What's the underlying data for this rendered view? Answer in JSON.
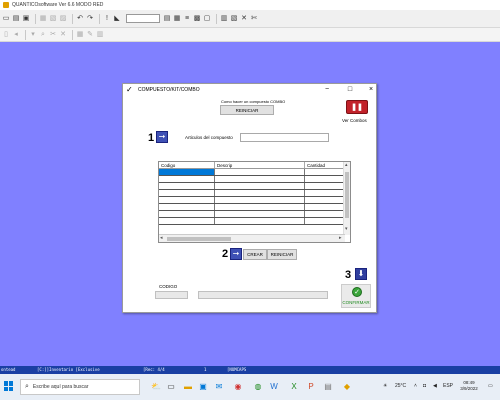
{
  "app": {
    "title": "QUANTICOsoftware Ver 6.6 MODO RED"
  },
  "dialog": {
    "title": "COMPUESTO/KIT/COMBO",
    "hint_text": "Como hacer un compuesto COMBO",
    "reiniciar_top_label": "REINICIAR",
    "logo_caption": "Ver Combos",
    "step1": "1",
    "step2": "2",
    "step3": "3",
    "articulos_label": "Articulos del compuesto",
    "grid_headers": [
      "Codigo",
      "Descrip",
      "Cantidad"
    ],
    "crear_label": "CREAR",
    "reiniciar_bottom_label": "REINICIAR",
    "codigo_label": "CODIGO",
    "confirmar_label": "CONFIRMAR"
  },
  "statusbar": {
    "item1": "ontead",
    "item2": "[C:]]Inventario [Exclusive",
    "item3": "[Rec: 4/4",
    "item4": "1",
    "item5": "[NUMCAPS"
  },
  "taskbar": {
    "search_placeholder": "Escribe aquí para buscar",
    "temperature": "25°C",
    "language": "ESP",
    "time": "08:49",
    "date": "3/9/2022"
  },
  "icons": {
    "close": "×",
    "maximize": "□",
    "minimize": "−"
  },
  "colors": {
    "desktop": "#8080ff",
    "statusbar": "#1a3fa3",
    "selection": "#0078d7",
    "confirm": "#3aa53a"
  }
}
